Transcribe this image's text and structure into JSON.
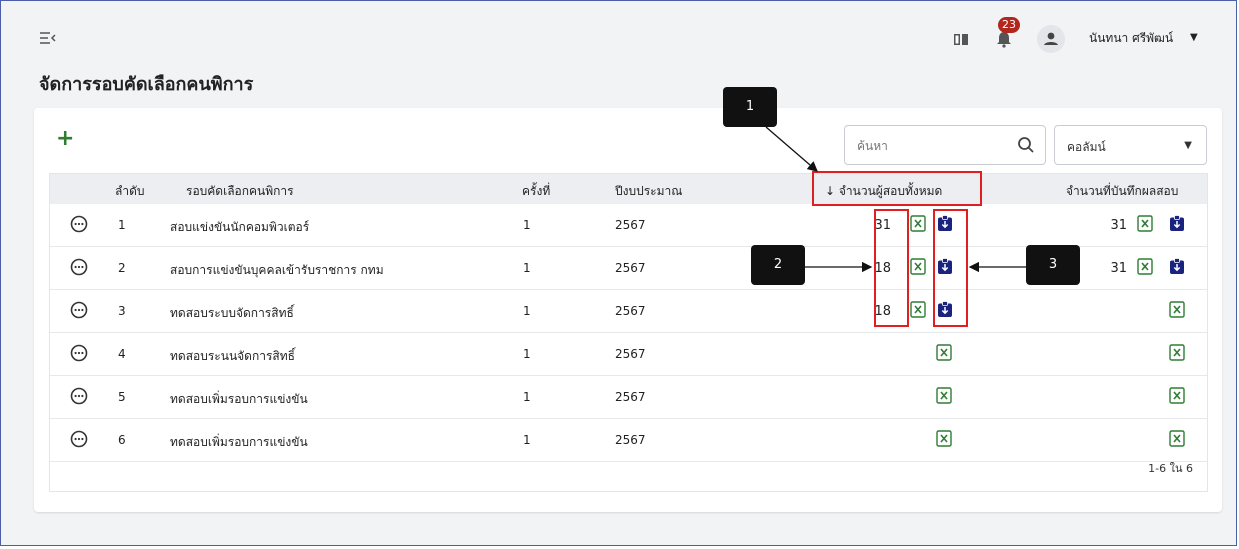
{
  "header": {
    "notification_count": "23",
    "user_name": "นันทนา ศรีพัฒน์"
  },
  "page_title": "จัดการรอบคัดเลือกคนพิการ",
  "toolbar": {
    "add_label": "+",
    "search_placeholder": "ค้นหา",
    "column_select_label": "คอลัมน์"
  },
  "table": {
    "headers": {
      "seq": "ลำดับ",
      "round": "รอบคัดเลือกคนพิการ",
      "time": "ครั้งที่",
      "year": "ปีงบประมาณ",
      "total": "↓ จำนวนผู้สอบทั้งหมด",
      "recorded": "จำนวนที่บันทึกผลสอบ"
    },
    "rows": [
      {
        "seq": "1",
        "round": "สอบแข่งขันนักคอมพิวเตอร์",
        "time": "1",
        "year": "2567",
        "total": "31",
        "recorded": "31"
      },
      {
        "seq": "2",
        "round": "สอบการแข่งขันบุคคลเข้ารับราชการ กทม",
        "time": "1",
        "year": "2567",
        "total": "18",
        "recorded": "31"
      },
      {
        "seq": "3",
        "round": "ทดสอบระบบจัดการสิทธิ์",
        "time": "1",
        "year": "2567",
        "total": "18",
        "recorded": ""
      },
      {
        "seq": "4",
        "round": "ทดสอบระนนจัดการสิทธิ์",
        "time": "1",
        "year": "2567",
        "total": "",
        "recorded": ""
      },
      {
        "seq": "5",
        "round": "ทดสอบเพิ่มรอบการแข่งขัน",
        "time": "1",
        "year": "2567",
        "total": "",
        "recorded": ""
      },
      {
        "seq": "6",
        "round": "ทดสอบเพิ่มรอบการแข่งขัน",
        "time": "1",
        "year": "2567",
        "total": "",
        "recorded": ""
      }
    ],
    "pagination": "1-6 ใน 6"
  },
  "callouts": [
    "1",
    "2",
    "3"
  ],
  "colors": {
    "accent_green": "#2e7d32",
    "download_blue": "#1a237e",
    "callout_red": "#e02020",
    "badge_red": "#b3261e"
  }
}
